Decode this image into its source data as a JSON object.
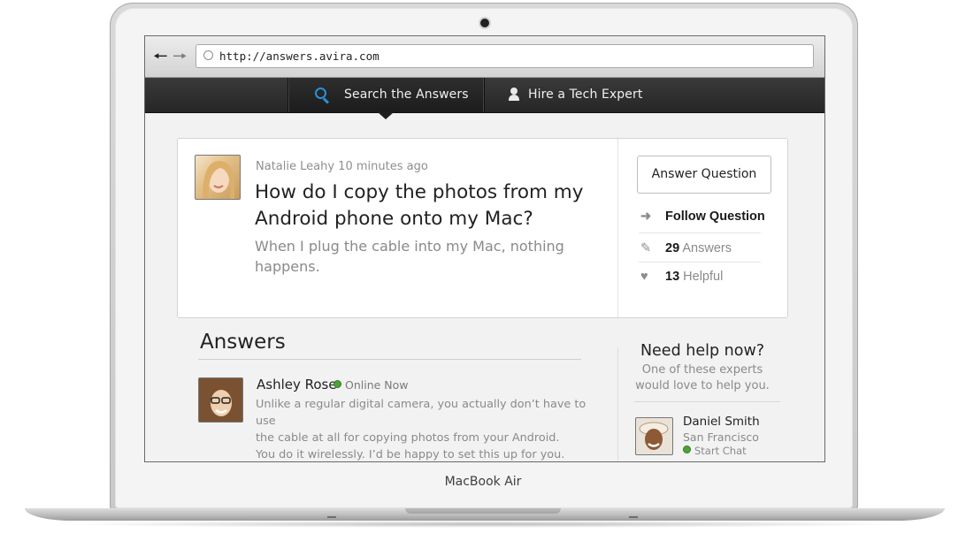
{
  "device": {
    "brand_label": "MacBook Air"
  },
  "browser": {
    "url": "http://answers.avira.com",
    "back_icon": "arrow-left-icon",
    "forward_icon": "arrow-right-icon"
  },
  "nav": {
    "tabs": [
      {
        "label": "Search the Answers",
        "icon": "search-icon",
        "active": true
      },
      {
        "label": "Hire a Tech Expert",
        "icon": "person-icon",
        "active": false
      }
    ],
    "accent": "#2b91d9"
  },
  "question": {
    "author": "Natalie Leahy",
    "time": "10 minutes ago",
    "title": "How do I copy the photos from my Android phone onto my Mac?",
    "body": "When I plug the cable into my Mac, nothing happens.",
    "actions": {
      "answer_button": "Answer Question",
      "follow": "Follow Question",
      "answers_count": "29",
      "answers_label": "Answers",
      "helpful_count": "13",
      "helpful_label": "Helpful"
    }
  },
  "answers": {
    "heading": "Answers",
    "items": [
      {
        "name": "Ashley Rose",
        "status": "Online Now",
        "lines": [
          "Unlike a regular digital camera, you actually don’t have to use",
          "the cable at all for copying photos from your Android.",
          "You do it wirelessly. I’d be happy to set this up for you."
        ]
      }
    ]
  },
  "help": {
    "title": "Need help now?",
    "subtitle_lines": [
      "One of these experts",
      "would love to help you."
    ],
    "experts": [
      {
        "name": "Daniel Smith",
        "city": "San Francisco",
        "action": "Start Chat"
      }
    ]
  },
  "colors": {
    "online": "#4da33a"
  }
}
